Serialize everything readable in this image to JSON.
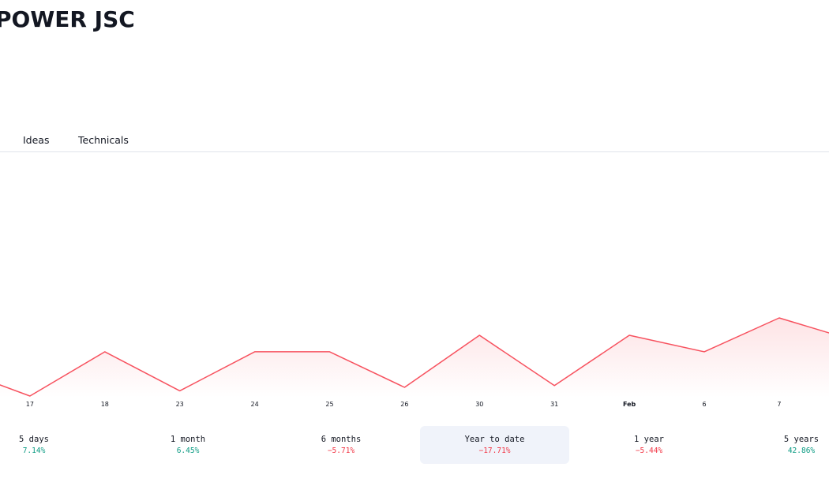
{
  "header": {
    "title": "POWER JSC"
  },
  "tabs": [
    {
      "label": "Ideas"
    },
    {
      "label": "Technicals"
    }
  ],
  "chart_data": {
    "type": "area",
    "x": [
      "",
      "17",
      "18",
      "23",
      "24",
      "25",
      "26",
      "30",
      "31",
      "Feb",
      "6",
      "7",
      ""
    ],
    "tick_labels": [
      "17",
      "18",
      "23",
      "24",
      "25",
      "26",
      "30",
      "31",
      "Feb",
      "6",
      "7"
    ],
    "series": [
      {
        "values": [
          1.6,
          0,
          2.55,
          0.3,
          2.55,
          2.55,
          0.5,
          3.5,
          0.6,
          3.5,
          2.55,
          4.5,
          3.2
        ]
      }
    ],
    "line_color": "#f7525f",
    "fill_color": "#fde3e5"
  },
  "periods": [
    {
      "label": "5 days",
      "change": "7.14%",
      "direction": "up",
      "active": false
    },
    {
      "label": "1 month",
      "change": "6.45%",
      "direction": "up",
      "active": false
    },
    {
      "label": "6 months",
      "change": "−5.71%",
      "direction": "down",
      "active": false
    },
    {
      "label": "Year to date",
      "change": "−17.71%",
      "direction": "down",
      "active": true
    },
    {
      "label": "1 year",
      "change": "−5.44%",
      "direction": "down",
      "active": false
    },
    {
      "label": "5 years",
      "change": "42.86%",
      "direction": "up",
      "active": false
    }
  ],
  "colors": {
    "positive": "#089981",
    "negative": "#f23645",
    "active_bg": "#f0f3fa",
    "divider": "#e0e3eb"
  }
}
